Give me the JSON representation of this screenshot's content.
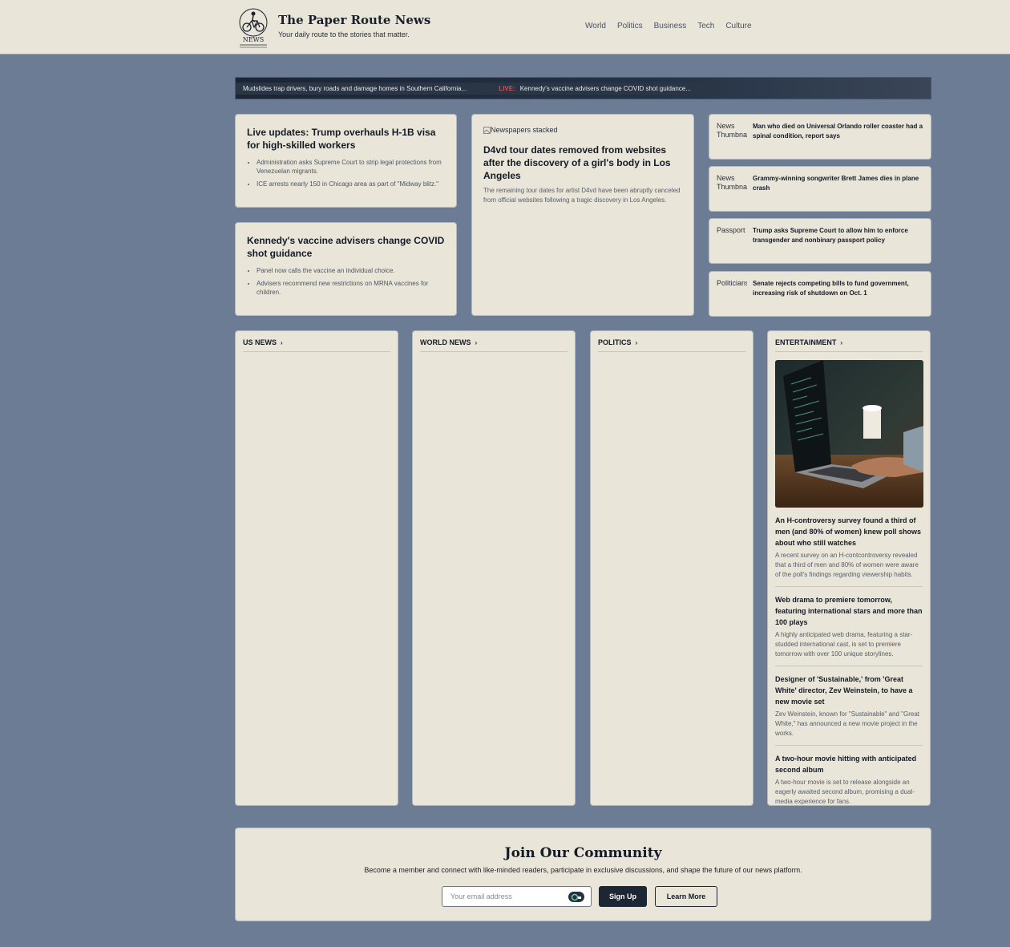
{
  "header": {
    "site_title": "The Paper Route News",
    "tagline": "Your daily route to the stories that matter.",
    "logo_text": "NEWS",
    "nav": [
      "World",
      "Politics",
      "Business",
      "Tech",
      "Culture"
    ]
  },
  "ticker": {
    "item1": "Mudslides trap drivers, bury roads and damage homes in Southern California...",
    "live_label": "LIVE:",
    "item2": "Kennedy's vaccine advisers change COVID shot guidance..."
  },
  "top_left": [
    {
      "title": "Live updates: Trump overhauls H-1B visa for high-skilled workers",
      "bullets": [
        "Administration asks Supreme Court to strip legal protections from Venezuelan migrants.",
        "ICE arrests nearly 150 in Chicago area as part of \"Midway blitz.\""
      ]
    },
    {
      "title": "Kennedy's vaccine advisers change COVID shot guidance",
      "bullets": [
        "Panel now calls the vaccine an individual choice.",
        "Advisers recommend new restrictions on MRNA vaccines for children."
      ]
    }
  ],
  "featured": {
    "image_alt": "Newspapers stacked",
    "title": "D4vd tour dates removed from websites after the discovery of a girl's body in Los Angeles",
    "summary": "The remaining tour dates for artist D4vd have been abruptly canceled from official websites following a tragic discovery in Los Angeles."
  },
  "side_stories": [
    {
      "thumb_alt": "News Thumbnail",
      "title": "Man who died on Universal Orlando roller coaster had a spinal condition, report says"
    },
    {
      "thumb_alt": "News Thumbnail",
      "title": "Grammy-winning songwriter Brett James dies in plane crash"
    },
    {
      "thumb_alt": "Passport",
      "title": "Trump asks Supreme Court to allow him to enforce transgender and nonbinary passport policy"
    },
    {
      "thumb_alt": "Politicians",
      "title": "Senate rejects competing bills to fund government, increasing risk of shutdown on Oct. 1"
    }
  ],
  "sections": {
    "us_news": "US NEWS",
    "world_news": "WORLD NEWS",
    "politics": "POLITICS",
    "entertainment": "ENTERTAINMENT",
    "chevron": "›"
  },
  "entertainment_items": [
    {
      "title": "An H-controversy survey found a third of men (and 80% of women) knew poll shows about who still watches",
      "desc": "A recent survey on an H-contcontroversy revealed that a third of men and 80% of women were aware of the poll's findings regarding viewership habits."
    },
    {
      "title": "Web drama to premiere tomorrow, featuring international stars and more than 100 plays",
      "desc": "A highly anticipated web drama, featuring a star-studded international cast, is set to premiere tomorrow with over 100 unique storylines."
    },
    {
      "title": "Designer of 'Sustainable,' from 'Great White' director, Zev Weinstein, to have a new movie set",
      "desc": "Zev Weinstein, known for \"Sustainable\" and \"Great White,\" has announced a new movie project in the works."
    },
    {
      "title": "A two-hour movie hitting with anticipated second album",
      "desc": "A two-hour movie is set to release alongside an eagerly awaited second album, promising a dual-media experience for fans."
    }
  ],
  "community": {
    "title": "Join Our Community",
    "subtitle": "Become a member and connect with like-minded readers, participate in exclusive discussions, and shape the future of our news platform.",
    "email_placeholder": "Your email address",
    "signup_label": "Sign Up",
    "learn_more_label": "Learn More"
  }
}
